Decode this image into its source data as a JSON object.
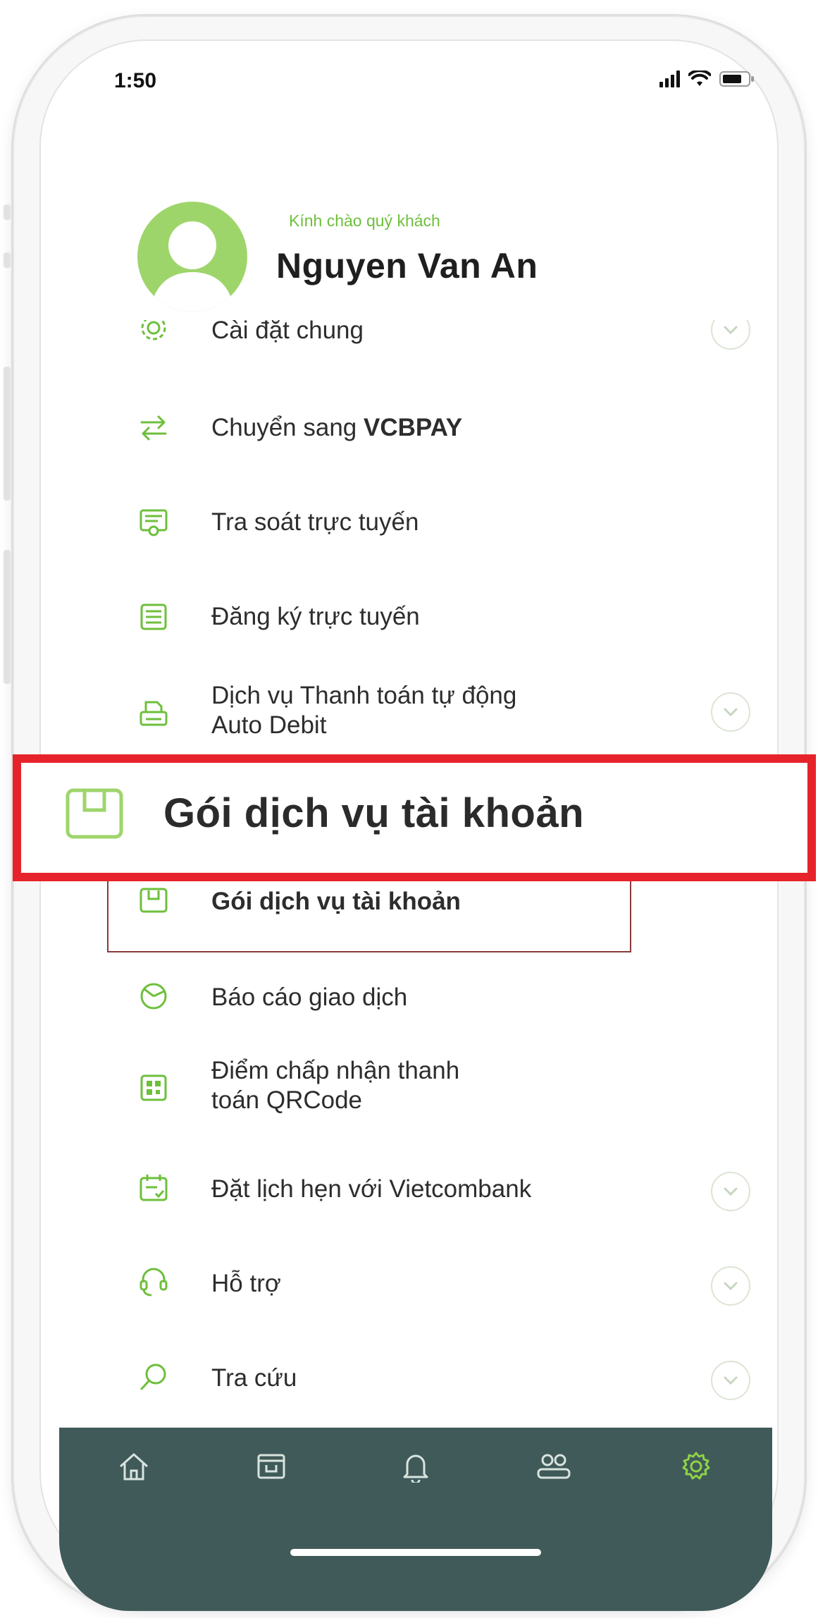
{
  "status_bar": {
    "time": "1:50"
  },
  "header": {
    "greeting": "Kính chào quý khách",
    "user_name": "Nguyen Van An"
  },
  "callout": {
    "label": "Gói dịch vụ tài khoản"
  },
  "menu": {
    "items": [
      {
        "icon": "gear-icon",
        "label": "Cài đặt chung",
        "expandable": true
      },
      {
        "icon": "swap-arrows-icon",
        "label_prefix": "Chuyển sang ",
        "label_bold": "VCBPAY",
        "expandable": false
      },
      {
        "icon": "search-document-icon",
        "label": "Tra soát trực tuyến",
        "expandable": false
      },
      {
        "icon": "form-document-icon",
        "label": "Đăng ký trực tuyến",
        "expandable": false
      },
      {
        "icon": "printer-icon",
        "label_line1": "Dịch vụ Thanh toán tự động",
        "label_line2": "Auto Debit",
        "expandable": true
      },
      {
        "icon": "package-icon",
        "label": "Gói dịch vụ tài khoản",
        "expandable": false
      },
      {
        "icon": "pie-chart-icon",
        "label": "Báo cáo giao dịch",
        "expandable": false
      },
      {
        "icon": "qr-code-icon",
        "label_line1": "Điểm chấp nhận thanh",
        "label_line2": "toán QRCode",
        "expandable": false
      },
      {
        "icon": "calendar-icon",
        "label": "Đặt lịch hẹn với Vietcombank",
        "expandable": true
      },
      {
        "icon": "headset-icon",
        "label": "Hỗ trợ",
        "expandable": true
      },
      {
        "icon": "search-icon",
        "label": "Tra cứu",
        "expandable": true
      }
    ]
  },
  "bottom_nav": {
    "items": [
      {
        "icon": "home-icon",
        "active": false
      },
      {
        "icon": "archive-icon",
        "active": false
      },
      {
        "icon": "bell-icon",
        "active": false
      },
      {
        "icon": "people-icon",
        "active": false
      },
      {
        "icon": "settings-icon",
        "active": true
      }
    ]
  },
  "colors": {
    "accent_green": "#6ebf3c",
    "nav_background": "#405a59",
    "callout_border": "#e6232a"
  }
}
